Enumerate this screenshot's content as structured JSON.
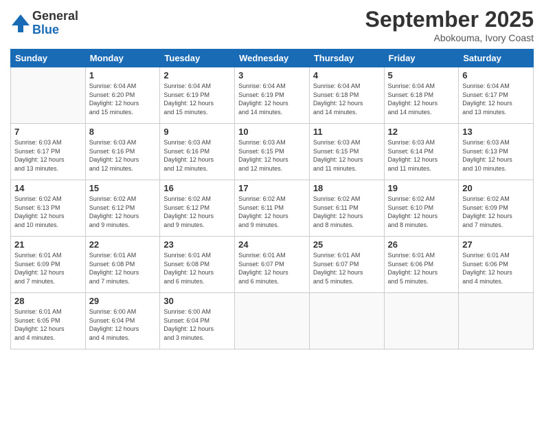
{
  "logo": {
    "general": "General",
    "blue": "Blue"
  },
  "header": {
    "title": "September 2025",
    "location": "Abokouma, Ivory Coast"
  },
  "weekdays": [
    "Sunday",
    "Monday",
    "Tuesday",
    "Wednesday",
    "Thursday",
    "Friday",
    "Saturday"
  ],
  "weeks": [
    [
      {
        "day": "",
        "info": ""
      },
      {
        "day": "1",
        "info": "Sunrise: 6:04 AM\nSunset: 6:20 PM\nDaylight: 12 hours\nand 15 minutes."
      },
      {
        "day": "2",
        "info": "Sunrise: 6:04 AM\nSunset: 6:19 PM\nDaylight: 12 hours\nand 15 minutes."
      },
      {
        "day": "3",
        "info": "Sunrise: 6:04 AM\nSunset: 6:19 PM\nDaylight: 12 hours\nand 14 minutes."
      },
      {
        "day": "4",
        "info": "Sunrise: 6:04 AM\nSunset: 6:18 PM\nDaylight: 12 hours\nand 14 minutes."
      },
      {
        "day": "5",
        "info": "Sunrise: 6:04 AM\nSunset: 6:18 PM\nDaylight: 12 hours\nand 14 minutes."
      },
      {
        "day": "6",
        "info": "Sunrise: 6:04 AM\nSunset: 6:17 PM\nDaylight: 12 hours\nand 13 minutes."
      }
    ],
    [
      {
        "day": "7",
        "info": "Sunrise: 6:03 AM\nSunset: 6:17 PM\nDaylight: 12 hours\nand 13 minutes."
      },
      {
        "day": "8",
        "info": "Sunrise: 6:03 AM\nSunset: 6:16 PM\nDaylight: 12 hours\nand 12 minutes."
      },
      {
        "day": "9",
        "info": "Sunrise: 6:03 AM\nSunset: 6:16 PM\nDaylight: 12 hours\nand 12 minutes."
      },
      {
        "day": "10",
        "info": "Sunrise: 6:03 AM\nSunset: 6:15 PM\nDaylight: 12 hours\nand 12 minutes."
      },
      {
        "day": "11",
        "info": "Sunrise: 6:03 AM\nSunset: 6:15 PM\nDaylight: 12 hours\nand 11 minutes."
      },
      {
        "day": "12",
        "info": "Sunrise: 6:03 AM\nSunset: 6:14 PM\nDaylight: 12 hours\nand 11 minutes."
      },
      {
        "day": "13",
        "info": "Sunrise: 6:03 AM\nSunset: 6:13 PM\nDaylight: 12 hours\nand 10 minutes."
      }
    ],
    [
      {
        "day": "14",
        "info": "Sunrise: 6:02 AM\nSunset: 6:13 PM\nDaylight: 12 hours\nand 10 minutes."
      },
      {
        "day": "15",
        "info": "Sunrise: 6:02 AM\nSunset: 6:12 PM\nDaylight: 12 hours\nand 9 minutes."
      },
      {
        "day": "16",
        "info": "Sunrise: 6:02 AM\nSunset: 6:12 PM\nDaylight: 12 hours\nand 9 minutes."
      },
      {
        "day": "17",
        "info": "Sunrise: 6:02 AM\nSunset: 6:11 PM\nDaylight: 12 hours\nand 9 minutes."
      },
      {
        "day": "18",
        "info": "Sunrise: 6:02 AM\nSunset: 6:11 PM\nDaylight: 12 hours\nand 8 minutes."
      },
      {
        "day": "19",
        "info": "Sunrise: 6:02 AM\nSunset: 6:10 PM\nDaylight: 12 hours\nand 8 minutes."
      },
      {
        "day": "20",
        "info": "Sunrise: 6:02 AM\nSunset: 6:09 PM\nDaylight: 12 hours\nand 7 minutes."
      }
    ],
    [
      {
        "day": "21",
        "info": "Sunrise: 6:01 AM\nSunset: 6:09 PM\nDaylight: 12 hours\nand 7 minutes."
      },
      {
        "day": "22",
        "info": "Sunrise: 6:01 AM\nSunset: 6:08 PM\nDaylight: 12 hours\nand 7 minutes."
      },
      {
        "day": "23",
        "info": "Sunrise: 6:01 AM\nSunset: 6:08 PM\nDaylight: 12 hours\nand 6 minutes."
      },
      {
        "day": "24",
        "info": "Sunrise: 6:01 AM\nSunset: 6:07 PM\nDaylight: 12 hours\nand 6 minutes."
      },
      {
        "day": "25",
        "info": "Sunrise: 6:01 AM\nSunset: 6:07 PM\nDaylight: 12 hours\nand 5 minutes."
      },
      {
        "day": "26",
        "info": "Sunrise: 6:01 AM\nSunset: 6:06 PM\nDaylight: 12 hours\nand 5 minutes."
      },
      {
        "day": "27",
        "info": "Sunrise: 6:01 AM\nSunset: 6:06 PM\nDaylight: 12 hours\nand 4 minutes."
      }
    ],
    [
      {
        "day": "28",
        "info": "Sunrise: 6:01 AM\nSunset: 6:05 PM\nDaylight: 12 hours\nand 4 minutes."
      },
      {
        "day": "29",
        "info": "Sunrise: 6:00 AM\nSunset: 6:04 PM\nDaylight: 12 hours\nand 4 minutes."
      },
      {
        "day": "30",
        "info": "Sunrise: 6:00 AM\nSunset: 6:04 PM\nDaylight: 12 hours\nand 3 minutes."
      },
      {
        "day": "",
        "info": ""
      },
      {
        "day": "",
        "info": ""
      },
      {
        "day": "",
        "info": ""
      },
      {
        "day": "",
        "info": ""
      }
    ]
  ]
}
